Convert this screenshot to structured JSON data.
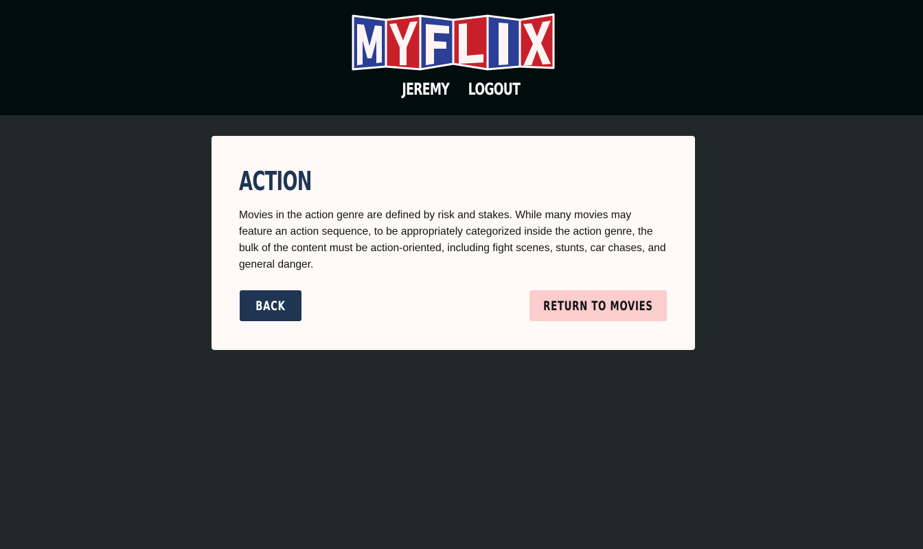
{
  "header": {
    "logo_text": "MYFLIX",
    "nav": {
      "user_label": "JEREMY",
      "logout_label": "LOGOUT"
    }
  },
  "genre": {
    "title": "ACTION",
    "description": "Movies in the action genre are defined by risk and stakes. While many movies may feature an action sequence, to be appropriately categorized inside the action genre, the bulk of the content must be action-oriented, including fight scenes, stunts, car chases, and general danger."
  },
  "actions": {
    "back_label": "BACK",
    "return_label": "RETURN TO MOVIES"
  },
  "colors": {
    "header_bg": "#010c0c",
    "page_bg": "#212828",
    "card_bg": "#fff9f8",
    "primary": "#1f3552",
    "secondary": "#fbcdcd",
    "logo_red": "#c8202a",
    "logo_blue": "#2a3f95"
  }
}
